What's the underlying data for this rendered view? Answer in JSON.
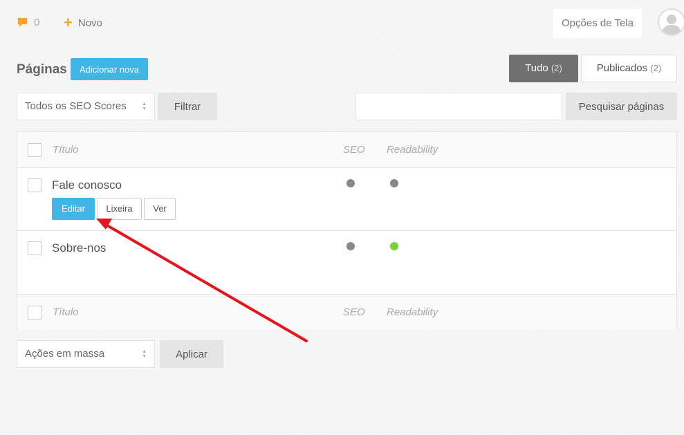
{
  "topbar": {
    "comments_count": "0",
    "new_label": "Novo",
    "screen_options_label": "Opções de Tela"
  },
  "page": {
    "title": "Páginas",
    "add_new_label": "Adicionar nova"
  },
  "filters": {
    "all_label": "Tudo",
    "all_count": "(2)",
    "published_label": "Publicados",
    "published_count": "(2)",
    "seo_select_value": "Todos os SEO Scores",
    "filter_button": "Filtrar",
    "search_value": "",
    "search_button": "Pesquisar páginas"
  },
  "table": {
    "columns": [
      "Título",
      "SEO",
      "Readability"
    ],
    "rows": [
      {
        "title": "Fale conosco",
        "seo_color": "#888888",
        "readability_color": "#888888",
        "actions": [
          "Editar",
          "Lixeira",
          "Ver"
        ]
      },
      {
        "title": "Sobre-nos",
        "seo_color": "#888888",
        "readability_color": "#7ad03a"
      }
    ]
  },
  "bulk": {
    "select_value": "Ações em massa",
    "apply_button": "Aplicar"
  },
  "colors": {
    "accent": "#3fb6e6",
    "active_tab": "#707070",
    "annotation_arrow": "#e8141c",
    "icon_orange": "#f5a623"
  },
  "icons": {
    "comments": "speech-bubble-icon",
    "new": "plus-icon",
    "avatar": "user-avatar-icon",
    "select_arrows": "updown-arrows-icon"
  }
}
